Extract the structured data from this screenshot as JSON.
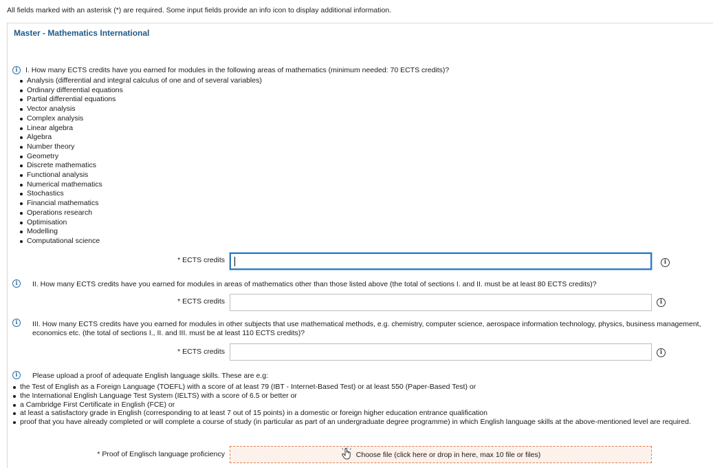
{
  "top_note": "All fields marked with an asterisk (*) are required. Some input fields provide an info icon to display additional information.",
  "panel_title": "Master - Mathematics International",
  "q1": {
    "text": "I. How many ECTS credits have you earned for modules in the following areas of mathematics (minimum needed: 70 ECTS credits)?",
    "items": [
      "Analysis (differential and integral calculus of one and of several variables)",
      "Ordinary differential equations",
      "Partial differential equations",
      "Vector analysis",
      "Complex analysis",
      "Linear algebra",
      "Algebra",
      "Number theory",
      "Geometry",
      "Discrete mathematics",
      "Functional analysis",
      "Numerical mathematics",
      "Stochastics",
      "Financial mathematics",
      "Operations research",
      "Optimisation",
      "Modelling",
      "Computational science"
    ],
    "field_label": "* ECTS credits",
    "value": ""
  },
  "q2": {
    "text": "II. How many ECTS credits have you earned for modules in areas of mathematics other than those listed above (the total of sections I. and II. must be at least 80 ECTS credits)?",
    "field_label": "* ECTS credits",
    "value": ""
  },
  "q3": {
    "text": "III. How many ECTS credits have you earned for modules in other subjects that use mathematical methods, e.g. chemistry, computer science, aerospace information technology, physics, business management, economics etc. (the total of sections I., II. and III. must be at least 110 ECTS credits)?",
    "field_label": "* ECTS credits",
    "value": ""
  },
  "q4": {
    "text": "Please upload a proof of adequate English language skills. These are e.g:",
    "items": [
      "the Test of English as a Foreign Language (TOEFL) with a score of at least 79 (IBT - Internet-Based Test) or at least 550 (Paper-Based Test) or",
      "the International English Language Test System (IELTS) with a score of 6.5 or better or",
      "a Cambridge First Certificate in English (FCE) or",
      "at least a satisfactory grade in English (corresponding to at least 7 out of 15 points) in a domestic or foreign higher education entrance qualification",
      "proof that you have already completed or will complete a course of study (in particular as part of an undergraduate degree programme) in which English language skills at the above-mentioned level are required."
    ],
    "field_label": "* Proof of Englisch language proficiency",
    "upload_label": "Choose file (click here or drop in here, max 10 file or files)"
  },
  "icons": {
    "info": "info-icon",
    "upload": "hand-pointer-icon"
  },
  "colors": {
    "title": "#1d5a8c",
    "focus_border": "#2c7ac6",
    "upload_border": "#e07a4a",
    "upload_bg": "#fdf1eb"
  }
}
